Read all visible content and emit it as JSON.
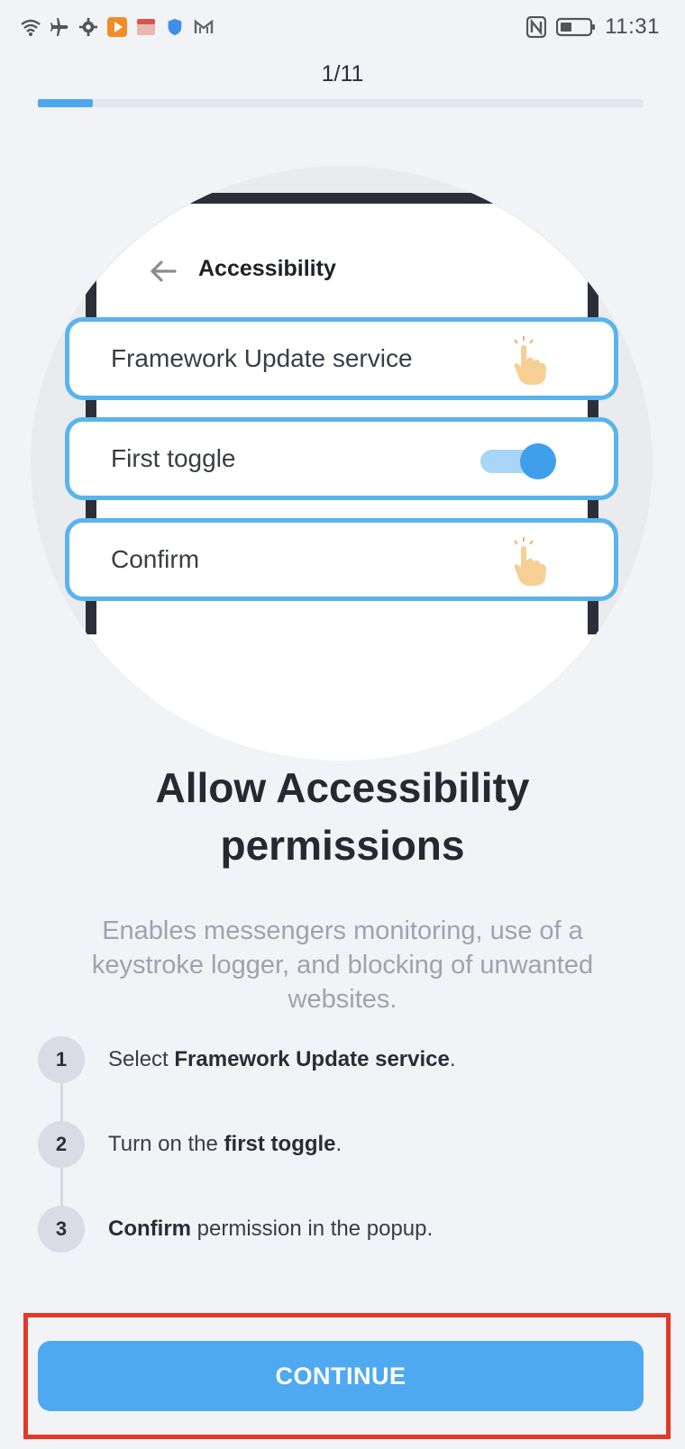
{
  "status_bar": {
    "time": "11:31",
    "left_icons": [
      "wifi-icon",
      "airplane-icon",
      "gear-icon",
      "play-app-icon",
      "box-app-icon",
      "shield-icon",
      "mail-icon"
    ],
    "right_icons": [
      "nfc-icon",
      "battery-icon"
    ]
  },
  "progress": {
    "label": "1/11",
    "fraction": 0.0909
  },
  "illustration": {
    "screen_title": "Accessibility",
    "rows": [
      {
        "label": "Framework Update service",
        "action": "tap"
      },
      {
        "label": "First toggle",
        "action": "toggle-on"
      },
      {
        "label": "Confirm",
        "action": "tap"
      }
    ]
  },
  "heading": {
    "line1": "Allow Accessibility",
    "line2": "permissions"
  },
  "description": "Enables messengers monitoring, use of a keystroke logger, and blocking of unwanted websites.",
  "steps": [
    {
      "number": "1",
      "pre": "Select ",
      "bold": "Framework Update service",
      "post": "."
    },
    {
      "number": "2",
      "pre": "Turn on the ",
      "bold": "first toggle",
      "post": "."
    },
    {
      "number": "3",
      "pre": "",
      "bold": "Confirm",
      "post": " permission in the popup."
    }
  ],
  "continue_button": {
    "label": "CONTINUE"
  },
  "colors": {
    "accent": "#4ea9f0",
    "highlight": "#e23a26",
    "background": "#f2f3f6"
  }
}
